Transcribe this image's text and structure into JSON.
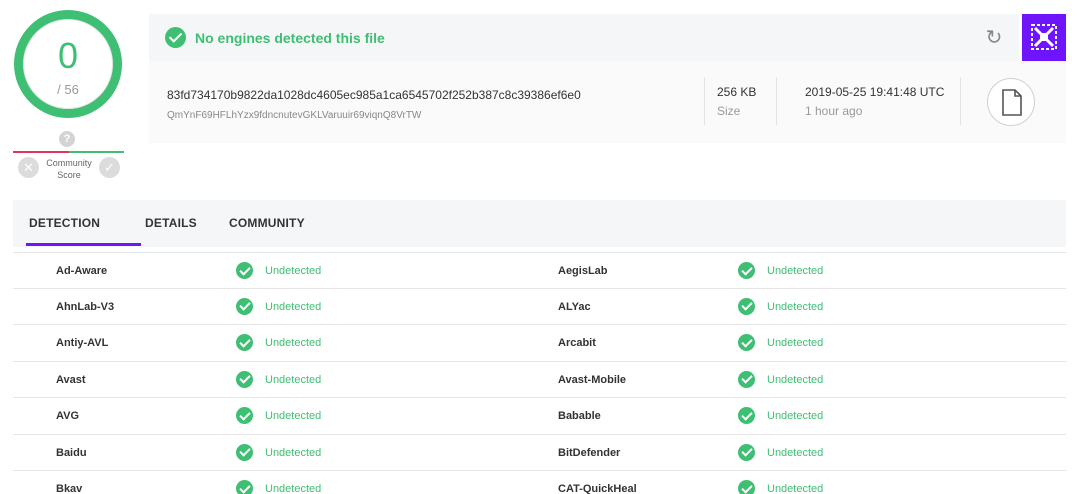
{
  "score": {
    "detected": "0",
    "total": "/ 56"
  },
  "community": {
    "label_line1": "Community",
    "label_line2": "Score",
    "question": "?"
  },
  "banner": {
    "message": "No engines detected this file"
  },
  "file": {
    "sha256": "83fd734170b9822da1028dc4605ec985a1ca6545702f252b387c8c39386ef6e0",
    "ipfs": "QmYnF69HFLhYzx9fdncnutevGKLVaruuir69viqnQ8VrTW",
    "size_value": "256 KB",
    "size_label": "Size",
    "date": "2019-05-25 19:41:48 UTC",
    "date_relative": "1 hour ago"
  },
  "tabs": [
    {
      "label": "DETECTION",
      "active": true
    },
    {
      "label": "DETAILS",
      "active": false
    },
    {
      "label": "COMMUNITY",
      "active": false
    }
  ],
  "results": [
    {
      "left": {
        "engine": "Ad-Aware",
        "result": "Undetected"
      },
      "right": {
        "engine": "AegisLab",
        "result": "Undetected"
      }
    },
    {
      "left": {
        "engine": "AhnLab-V3",
        "result": "Undetected"
      },
      "right": {
        "engine": "ALYac",
        "result": "Undetected"
      }
    },
    {
      "left": {
        "engine": "Antiy-AVL",
        "result": "Undetected"
      },
      "right": {
        "engine": "Arcabit",
        "result": "Undetected"
      }
    },
    {
      "left": {
        "engine": "Avast",
        "result": "Undetected"
      },
      "right": {
        "engine": "Avast-Mobile",
        "result": "Undetected"
      }
    },
    {
      "left": {
        "engine": "AVG",
        "result": "Undetected"
      },
      "right": {
        "engine": "Babable",
        "result": "Undetected"
      }
    },
    {
      "left": {
        "engine": "Baidu",
        "result": "Undetected"
      },
      "right": {
        "engine": "BitDefender",
        "result": "Undetected"
      }
    },
    {
      "left": {
        "engine": "Bkav",
        "result": "Undetected"
      },
      "right": {
        "engine": "CAT-QuickHeal",
        "result": "Undetected"
      }
    }
  ],
  "colors": {
    "accent": "#6f14ff",
    "clean": "#3fbf73",
    "malicious": "#e0365a"
  },
  "icons": {
    "reload": "reload-icon",
    "logo": "virustotal-logo",
    "file": "file-icon",
    "check": "check-circle-icon"
  }
}
